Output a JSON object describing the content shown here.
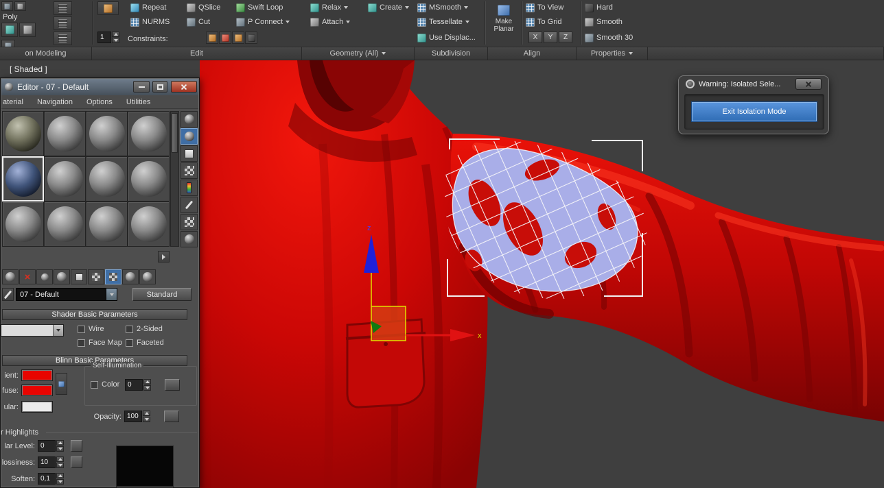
{
  "ribbon": {
    "poly_label": "Poly",
    "spinner_value": "1",
    "constraints_label": "Constraints:",
    "buttons": {
      "repeat": "Repeat",
      "qslice": "QSlice",
      "swift_loop": "Swift Loop",
      "nurms": "NURMS",
      "cut": "Cut",
      "p_connect": "P Connect",
      "relax": "Relax",
      "attach": "Attach",
      "create": "Create",
      "msmooth": "MSmooth",
      "tessellate": "Tessellate",
      "use_displace": "Use Displac...",
      "make_planar": "Make Planar",
      "to_view": "To View",
      "to_grid": "To Grid",
      "axis_x": "X",
      "axis_y": "Y",
      "axis_z": "Z",
      "hard": "Hard",
      "smooth": "Smooth",
      "smooth_30": "Smooth 30"
    },
    "sections": {
      "modeling": "on Modeling",
      "edit": "Edit",
      "geometry": "Geometry (All)",
      "subdivision": "Subdivision",
      "align": "Align",
      "properties": "Properties"
    }
  },
  "viewport": {
    "shading_label": "[ Shaded ]",
    "gizmo": {
      "z_label": "z",
      "x_label": "x"
    }
  },
  "material_editor": {
    "title": "Editor - 07 - Default",
    "menu": {
      "material": "aterial",
      "navigation": "Navigation",
      "options": "Options",
      "utilities": "Utilities"
    },
    "material_name": "07 - Default",
    "type_button": "Standard",
    "shader_rollout": {
      "title": "Shader Basic Parameters",
      "wire": "Wire",
      "two_sided": "2-Sided",
      "face_map": "Face Map",
      "faceted": "Faceted"
    },
    "blinn_rollout": {
      "title": "Blinn Basic Parameters",
      "ambient": "ient:",
      "diffuse": "fuse:",
      "specular": "ular:",
      "self_illumination": "Self-Illumination",
      "color": "Color",
      "self_illum_value": "0",
      "opacity_label": "Opacity:",
      "opacity_value": "100"
    },
    "highlights": {
      "title": "r Highlights",
      "specular_level_label": "lar Level:",
      "specular_level_value": "0",
      "glossiness_label": "lossiness:",
      "glossiness_value": "10",
      "soften_label": "Soften:",
      "soften_value": "0,1"
    }
  },
  "warning_dialog": {
    "title": "Warning: Isolated Sele...",
    "exit_button": "Exit Isolation Mode"
  },
  "colors": {
    "jacket_red": "#cb0705",
    "selection_lavender": "#a9aee8",
    "accent_blue": "#3f7cbf"
  }
}
